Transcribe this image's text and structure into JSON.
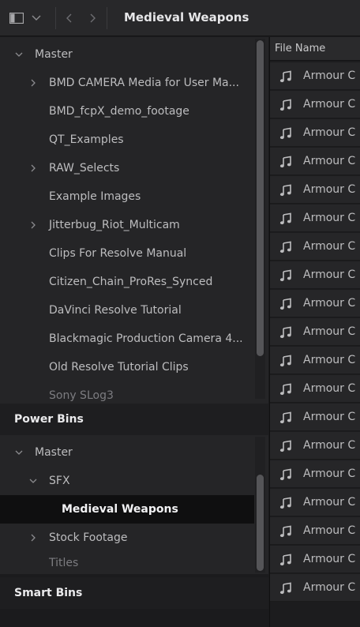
{
  "toolbar": {
    "panel_icon": "panel-toggle-icon",
    "dropdown_icon": "chevron-down-icon",
    "back_icon": "chevron-left-icon",
    "forward_icon": "chevron-right-icon",
    "title": "Medieval Weapons"
  },
  "master_bins": {
    "root": "Master",
    "items": [
      {
        "label": "BMD CAMERA Media for User Ma...",
        "expandable": true
      },
      {
        "label": "BMD_fcpX_demo_footage",
        "expandable": false
      },
      {
        "label": "QT_Examples",
        "expandable": false
      },
      {
        "label": "RAW_Selects",
        "expandable": true
      },
      {
        "label": "Example Images",
        "expandable": false
      },
      {
        "label": "Jitterbug_Riot_Multicam",
        "expandable": true
      },
      {
        "label": "Clips For Resolve Manual",
        "expandable": false
      },
      {
        "label": "Citizen_Chain_ProRes_Synced",
        "expandable": false
      },
      {
        "label": "DaVinci Resolve Tutorial",
        "expandable": false
      },
      {
        "label": "Blackmagic Production Camera 4...",
        "expandable": false
      },
      {
        "label": "Old Resolve Tutorial Clips",
        "expandable": false
      },
      {
        "label": "Sony SLog3",
        "expandable": false
      }
    ]
  },
  "power_bins": {
    "header": "Power Bins",
    "root": "Master",
    "sfx": "SFX",
    "selected": "Medieval Weapons",
    "stock": "Stock Footage",
    "titles": "Titles"
  },
  "smart_bins": {
    "header": "Smart Bins"
  },
  "file_list": {
    "column_header": "File Name",
    "file_icon": "audio-note-icon",
    "rows": [
      "Armour C",
      "Armour C",
      "Armour C",
      "Armour C",
      "Armour C",
      "Armour C",
      "Armour C",
      "Armour C",
      "Armour C",
      "Armour C",
      "Armour C",
      "Armour C",
      "Armour C",
      "Armour C",
      "Armour C",
      "Armour C",
      "Armour C",
      "Armour C",
      "Armour C"
    ]
  }
}
